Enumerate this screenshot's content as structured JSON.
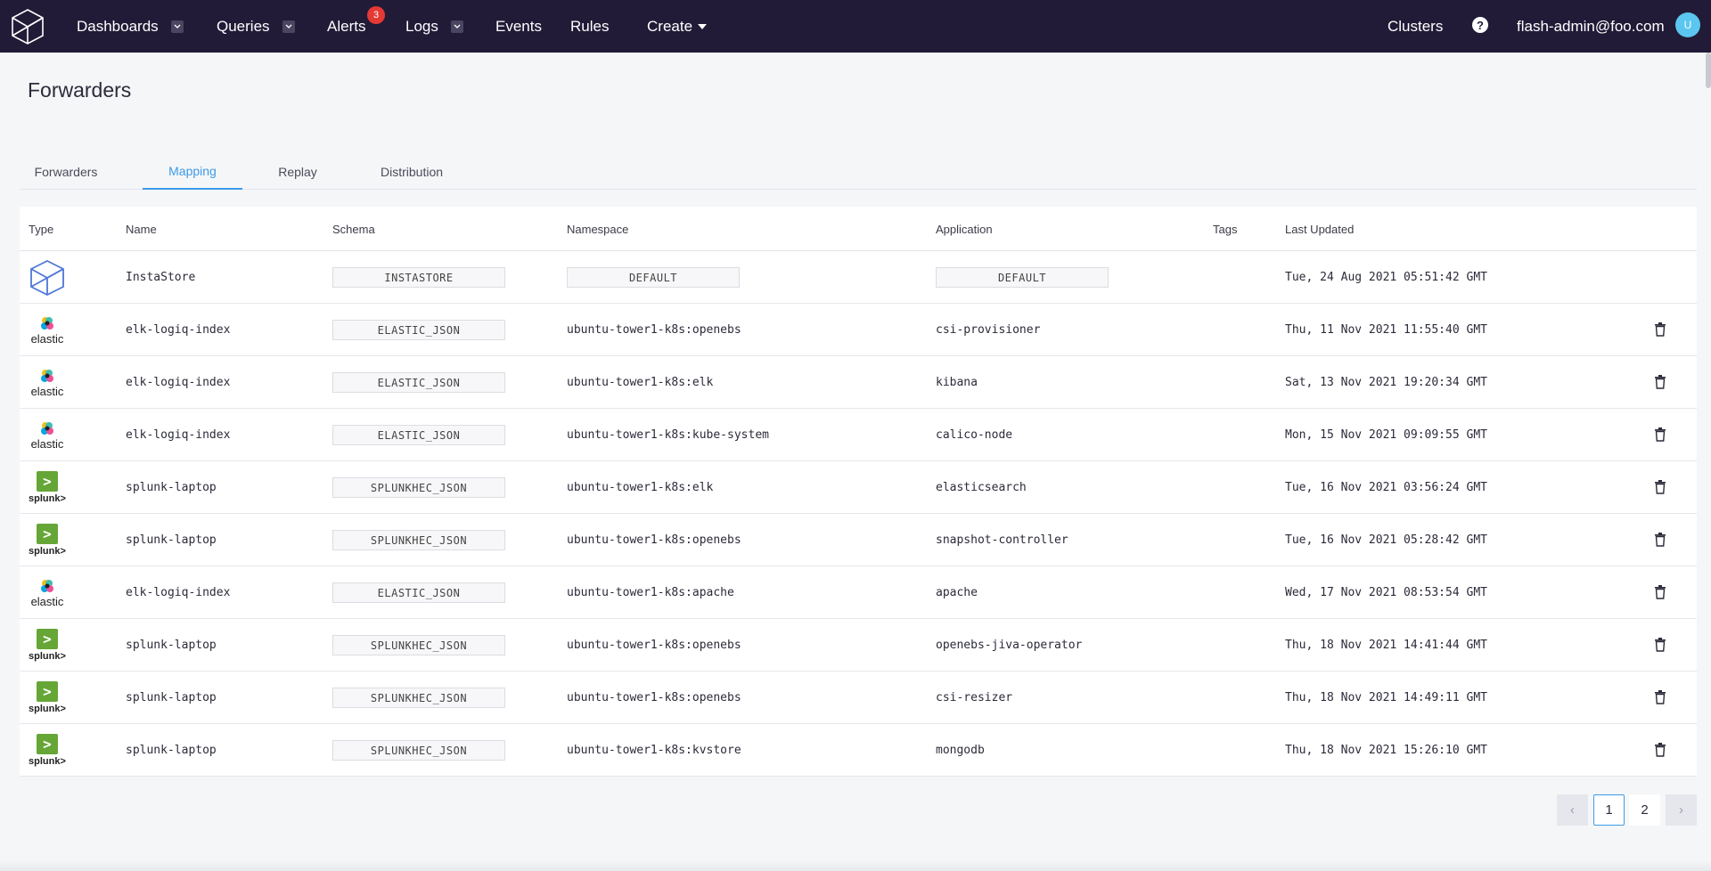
{
  "nav": {
    "items": [
      {
        "label": "Dashboards",
        "has_caret": true
      },
      {
        "label": "Queries",
        "has_caret": true
      },
      {
        "label": "Alerts",
        "badge": "3"
      },
      {
        "label": "Logs",
        "has_caret": true
      },
      {
        "label": "Events"
      },
      {
        "label": "Rules"
      },
      {
        "label": "Create"
      }
    ],
    "clusters": "Clusters",
    "help": "?",
    "user_email": "flash-admin@foo.com",
    "avatar_initial": "U"
  },
  "page": {
    "title": "Forwarders",
    "tabs": [
      "Forwarders",
      "Mapping",
      "Replay",
      "Distribution"
    ],
    "active_tab": "Mapping"
  },
  "table": {
    "headers": [
      "Type",
      "Name",
      "Schema",
      "Namespace",
      "Application",
      "Tags",
      "Last Updated"
    ],
    "rows": [
      {
        "type": "instastore",
        "name": "InstaStore",
        "schema": "INSTASTORE",
        "namespace": "DEFAULT",
        "application": "DEFAULT",
        "tags": "",
        "updated": "Tue, 24 Aug 2021 05:51:42 GMT"
      },
      {
        "type": "elastic",
        "type_label": "elastic",
        "name": "elk-logiq-index",
        "schema": "ELASTIC_JSON",
        "namespace": "ubuntu-tower1-k8s:openebs",
        "application": "csi-provisioner",
        "tags": "",
        "updated": "Thu, 11 Nov 2021 11:55:40 GMT"
      },
      {
        "type": "elastic",
        "type_label": "elastic",
        "name": "elk-logiq-index",
        "schema": "ELASTIC_JSON",
        "namespace": "ubuntu-tower1-k8s:elk",
        "application": "kibana",
        "tags": "",
        "updated": "Sat, 13 Nov 2021 19:20:34 GMT"
      },
      {
        "type": "elastic",
        "type_label": "elastic",
        "name": "elk-logiq-index",
        "schema": "ELASTIC_JSON",
        "namespace": "ubuntu-tower1-k8s:kube-system",
        "application": "calico-node",
        "tags": "",
        "updated": "Mon, 15 Nov 2021 09:09:55 GMT"
      },
      {
        "type": "splunk",
        "type_label": "splunk>",
        "name": "splunk-laptop",
        "schema": "SPLUNKHEC_JSON",
        "namespace": "ubuntu-tower1-k8s:elk",
        "application": "elasticsearch",
        "tags": "",
        "updated": "Tue, 16 Nov 2021 03:56:24 GMT"
      },
      {
        "type": "splunk",
        "type_label": "splunk>",
        "name": "splunk-laptop",
        "schema": "SPLUNKHEC_JSON",
        "namespace": "ubuntu-tower1-k8s:openebs",
        "application": "snapshot-controller",
        "tags": "",
        "updated": "Tue, 16 Nov 2021 05:28:42 GMT"
      },
      {
        "type": "elastic",
        "type_label": "elastic",
        "name": "elk-logiq-index",
        "schema": "ELASTIC_JSON",
        "namespace": "ubuntu-tower1-k8s:apache",
        "application": "apache",
        "tags": "",
        "updated": "Wed, 17 Nov 2021 08:53:54 GMT"
      },
      {
        "type": "splunk",
        "type_label": "splunk>",
        "name": "splunk-laptop",
        "schema": "SPLUNKHEC_JSON",
        "namespace": "ubuntu-tower1-k8s:openebs",
        "application": "openebs-jiva-operator",
        "tags": "",
        "updated": "Thu, 18 Nov 2021 14:41:44 GMT"
      },
      {
        "type": "splunk",
        "type_label": "splunk>",
        "name": "splunk-laptop",
        "schema": "SPLUNKHEC_JSON",
        "namespace": "ubuntu-tower1-k8s:openebs",
        "application": "csi-resizer",
        "tags": "",
        "updated": "Thu, 18 Nov 2021 14:49:11 GMT"
      },
      {
        "type": "splunk",
        "type_label": "splunk>",
        "name": "splunk-laptop",
        "schema": "SPLUNKHEC_JSON",
        "namespace": "ubuntu-tower1-k8s:kvstore",
        "application": "mongodb",
        "tags": "",
        "updated": "Thu, 18 Nov 2021 15:26:10 GMT"
      }
    ]
  },
  "pagination": {
    "prev": "‹",
    "pages": [
      "1",
      "2"
    ],
    "current": "1",
    "next": "›"
  },
  "colors": {
    "nav_bg": "#211b37",
    "accent": "#3d9ae8",
    "badge": "#e53935",
    "splunk_green": "#65a637"
  },
  "icons": {
    "row_action": "trash-icon",
    "logo": "cube-logo-icon"
  }
}
